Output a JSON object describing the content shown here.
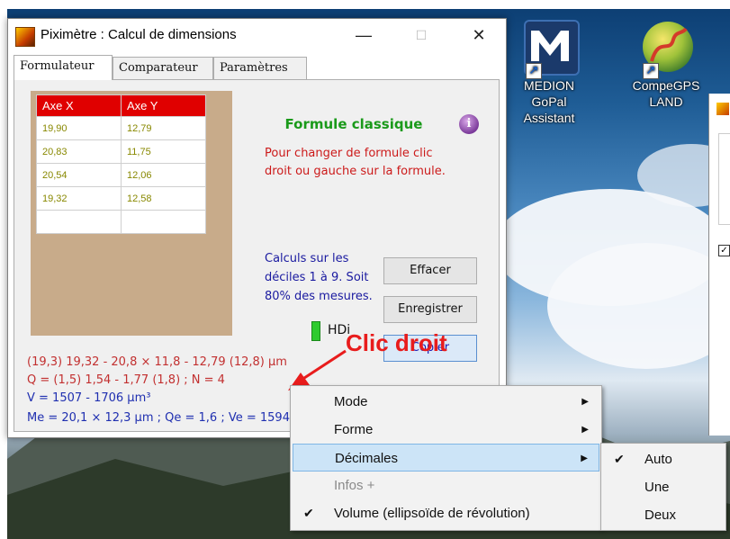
{
  "window": {
    "title": "Piximètre : Calcul de dimensions",
    "minimize": "—",
    "maximize": "☐",
    "close": "✕"
  },
  "tabs": [
    "Formulateur",
    "Comparateur",
    "Paramètres"
  ],
  "grid": {
    "headers": [
      "Axe X",
      "Axe Y"
    ],
    "rows": [
      [
        "19,90",
        "12,79"
      ],
      [
        "20,83",
        "11,75"
      ],
      [
        "20,54",
        "12,06"
      ],
      [
        "19,32",
        "12,58"
      ],
      [
        "",
        ""
      ]
    ]
  },
  "formula": {
    "title": "Formule classique",
    "info_glyph": "i",
    "hint": "Pour changer de formule clic droit ou gauche sur la formule.",
    "calc_note": "Calculs sur les déciles 1 à 9. Soit 80% des mesures."
  },
  "buttons": {
    "clear": "Effacer",
    "save": "Enregistrer",
    "copy": "Copier"
  },
  "hd_label": "HDi",
  "results": [
    "(19,3) 19,32 - 20,8 × 11,8 - 12,79 (12,8) µm",
    "Q = (1,5) 1,54 - 1,77 (1,8) ; N = 4",
    "V = 1507 - 1706 µm³",
    "Me = 20,1 × 12,3 µm ; Qe = 1,6 ; Ve = 1594"
  ],
  "colors": {
    "result_red": "#c23030",
    "result_blue": "#1f2fb0",
    "annotation_red": "#e81c1c"
  },
  "annotation": "Clic droit",
  "desktop_icons": [
    {
      "label1": "MEDION GoPal",
      "label2": "Assistant",
      "icon": "medion-m-icon"
    },
    {
      "label1": "CompeGPS",
      "label2": "LAND",
      "icon": "compegps-globe-icon"
    }
  ],
  "context_menu": {
    "items": [
      {
        "label": "Mode",
        "submenu": true,
        "checked": false,
        "disabled": false,
        "highlighted": false
      },
      {
        "label": "Forme",
        "submenu": true,
        "checked": false,
        "disabled": false,
        "highlighted": false
      },
      {
        "label": "Décimales",
        "submenu": true,
        "checked": false,
        "disabled": false,
        "highlighted": true
      },
      {
        "label": "Infos +",
        "submenu": false,
        "checked": false,
        "disabled": true,
        "highlighted": false
      },
      {
        "label": "Volume (ellipsoïde de révolution)",
        "submenu": false,
        "checked": true,
        "disabled": false,
        "highlighted": false
      }
    ],
    "submenu": {
      "items": [
        {
          "label": "Auto",
          "checked": true
        },
        {
          "label": "Une",
          "checked": false
        },
        {
          "label": "Deux",
          "checked": false
        }
      ]
    }
  }
}
